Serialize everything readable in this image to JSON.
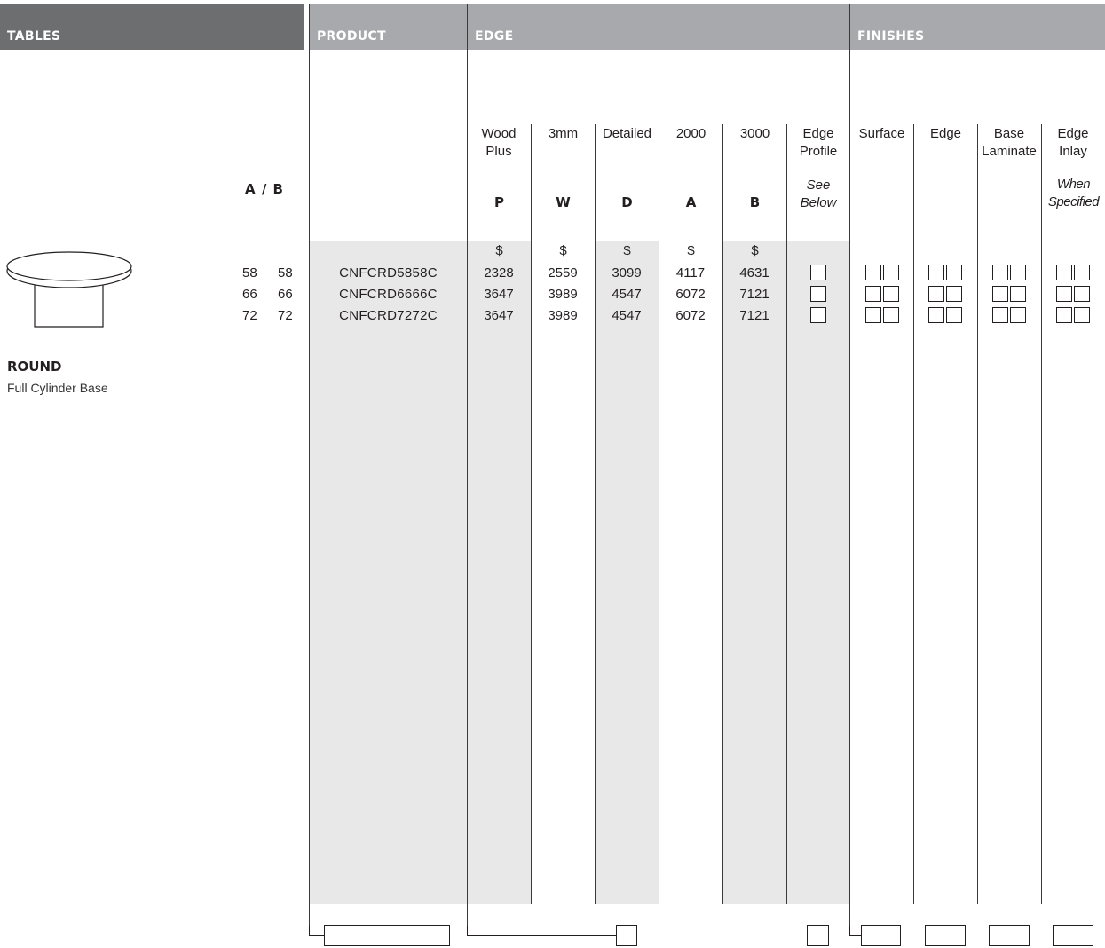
{
  "headers": {
    "tables": "TABLES",
    "product": "PRODUCT",
    "edge": "EDGE",
    "finishes": "FINISHES"
  },
  "size_label": "A / B",
  "columns": [
    {
      "label": "Wood Plus",
      "code": "P"
    },
    {
      "label": "3mm",
      "code": "W"
    },
    {
      "label": "Detailed",
      "code": "D"
    },
    {
      "label": "2000",
      "code": "A"
    },
    {
      "label": "3000",
      "code": "B"
    }
  ],
  "edge_profile": {
    "label": "Edge Profile",
    "note": "See Below"
  },
  "finish_columns": [
    {
      "label": "Surface",
      "note": ""
    },
    {
      "label": "Edge",
      "note": ""
    },
    {
      "label": "Base Laminate",
      "note": ""
    },
    {
      "label": "Edge Inlay",
      "note": "When Specified"
    }
  ],
  "currency": "$",
  "rows": [
    {
      "a": "58",
      "b": "58",
      "product": "CNFCRD5858C",
      "prices": [
        "2328",
        "2559",
        "3099",
        "4117",
        "4631"
      ]
    },
    {
      "a": "66",
      "b": "66",
      "product": "CNFCRD6666C",
      "prices": [
        "3647",
        "3989",
        "4547",
        "6072",
        "7121"
      ]
    },
    {
      "a": "72",
      "b": "72",
      "product": "CNFCRD7272C",
      "prices": [
        "3647",
        "3989",
        "4547",
        "6072",
        "7121"
      ]
    }
  ],
  "table_type": {
    "name": "ROUND",
    "description": "Full Cylinder Base"
  },
  "colors": {
    "header_dark": "#6d6e70",
    "header_light": "#a7a9ac",
    "shade": "#e7e8e7"
  }
}
